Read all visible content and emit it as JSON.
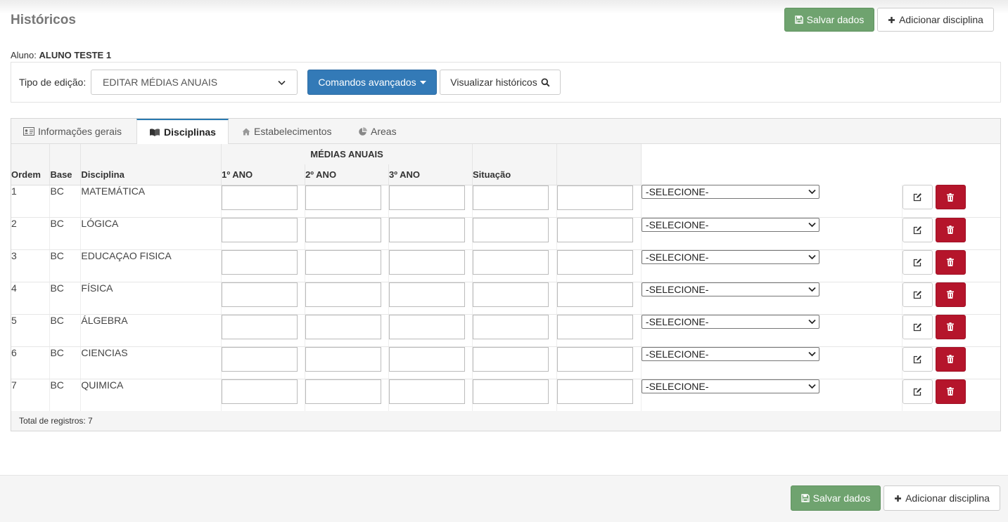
{
  "page": {
    "title": "Históricos",
    "save_label": "Salvar dados",
    "add_label": "Adicionar disciplina"
  },
  "student": {
    "label": "Aluno:",
    "name": "ALUNO TESTE 1"
  },
  "edit": {
    "label": "Tipo de edição:",
    "selected": "EDITAR MÉDIAS ANUAIS",
    "advanced_label": "Comandos avançados",
    "view_label": "Visualizar históricos"
  },
  "tabs": [
    {
      "label": "Informações gerais",
      "icon": "id-card-icon"
    },
    {
      "label": "Disciplinas",
      "icon": "book-icon",
      "active": true
    },
    {
      "label": "Estabelecimentos",
      "icon": "home-icon"
    },
    {
      "label": "Areas",
      "icon": "pie-chart-icon"
    }
  ],
  "table": {
    "group_header": "MÉDIAS ANUAIS",
    "columns": {
      "ordem": "Ordem",
      "base": "Base",
      "disciplina": "Disciplina",
      "ano1": "1º ANO",
      "ano2": "2º ANO",
      "ano3": "3º ANO",
      "situacao": "Situação"
    },
    "select_placeholder": "-SELECIONE-",
    "rows": [
      {
        "ordem": "1",
        "base": "BC",
        "disciplina": "MATEMÁTICA"
      },
      {
        "ordem": "2",
        "base": "BC",
        "disciplina": "LÓGICA"
      },
      {
        "ordem": "3",
        "base": "BC",
        "disciplina": "EDUCAÇAO FISICA"
      },
      {
        "ordem": "4",
        "base": "BC",
        "disciplina": "FÍSICA"
      },
      {
        "ordem": "5",
        "base": "BC",
        "disciplina": "ÁLGEBRA"
      },
      {
        "ordem": "6",
        "base": "BC",
        "disciplina": "CIENCIAS"
      },
      {
        "ordem": "7",
        "base": "BC",
        "disciplina": "QUIMICA"
      }
    ],
    "footer": "Total de registros: 7"
  },
  "colors": {
    "green": "#6fa36f",
    "blue": "#337ab7",
    "red": "#b5152b"
  }
}
